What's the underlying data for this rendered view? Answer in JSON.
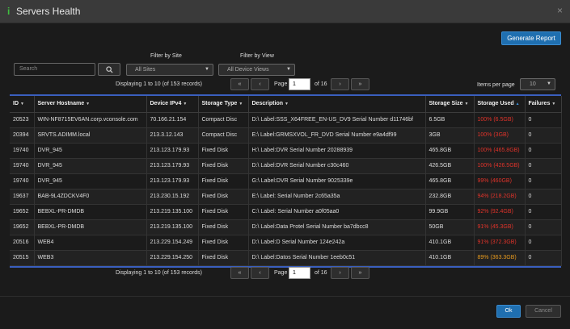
{
  "window": {
    "title": "Servers Health",
    "close_glyph": "×",
    "icon": "info-icon"
  },
  "toolbar": {
    "generate_report": "Generate Report"
  },
  "filters": {
    "search_placeholder": "Search",
    "site_label": "Filter by Site",
    "site_value": "All Sites",
    "view_label": "Filter by View",
    "view_value": "All Device Views"
  },
  "pager": {
    "top_info": "Displaying 1 to 10 (of 153 records)",
    "bottom_info": "Displaying 1 to 10 (of 153 records)",
    "first": "«",
    "prev": "‹",
    "next": "›",
    "last": "»",
    "page_label": "Page",
    "page_value": "1",
    "of_label": "of 16",
    "items_per_page_label": "Items per page",
    "items_per_page": "10"
  },
  "table": {
    "columns": [
      "ID",
      "Server Hostname",
      "Device IPv4",
      "Storage Type",
      "Description",
      "Storage Size",
      "Storage Used",
      "Failures"
    ],
    "rows": [
      [
        "20523",
        "WIN-NF8715EV6AN.corp.vconsole.com",
        "70.166.21.154",
        "Compact Disc",
        "D:\\ Label:SSS_X64FREE_EN-US_DV9 Serial Number d11746bf",
        "6.5GB",
        "100% (6.5GB)",
        "0"
      ],
      [
        "20394",
        "SRVTS.ADIMM.local",
        "213.3.12.143",
        "Compact Disc",
        "E:\\ Label:GRMSXVOL_FR_DVD Serial Number e9a4df99",
        "3GB",
        "100% (3GB)",
        "0"
      ],
      [
        "19740",
        "DVR_945",
        "213.123.179.93",
        "Fixed Disk",
        "H:\\ Label:DVR Serial Number 20288939",
        "465.8GB",
        "100% (465.8GB)",
        "0"
      ],
      [
        "19740",
        "DVR_945",
        "213.123.179.93",
        "Fixed Disk",
        "D:\\ Label:DVR Serial Number c30c460",
        "426.5GB",
        "100% (426.5GB)",
        "0"
      ],
      [
        "19740",
        "DVR_945",
        "213.123.179.93",
        "Fixed Disk",
        "G:\\ Label:DVR Serial Number 9025339e",
        "465.8GB",
        "99% (460GB)",
        "0"
      ],
      [
        "19637",
        "BAB-9L4ZDCKV4F0",
        "213.230.15.192",
        "Fixed Disk",
        "E:\\ Label: Serial Number 2c65a35a",
        "232.8GB",
        "94% (218.2GB)",
        "0"
      ],
      [
        "19652",
        "BEBXL-PR-DMDB",
        "213.219.135.100",
        "Fixed Disk",
        "C:\\ Label: Serial Number a0f05aa0",
        "99.9GB",
        "92% (92.4GB)",
        "0"
      ],
      [
        "19652",
        "BEBXL-PR-DMDB",
        "213.219.135.100",
        "Fixed Disk",
        "D:\\ Label:Data Protel Serial Number ba7dbcc8",
        "50GB",
        "91% (45.3GB)",
        "0"
      ],
      [
        "20516",
        "WEB4",
        "213.229.154.249",
        "Fixed Disk",
        "D:\\ Label:D Serial Number 124e242a",
        "410.1GB",
        "91% (372.3GB)",
        "0"
      ],
      [
        "20515",
        "WEB3",
        "213.229.154.250",
        "Fixed Disk",
        "D:\\ Label:Datos Serial Number 1eeb0c51",
        "410.1GB",
        "89% (363.3GB)",
        "0"
      ]
    ],
    "used_colors": [
      "red",
      "red",
      "red",
      "red",
      "red",
      "red",
      "red",
      "red",
      "red",
      "orange"
    ]
  },
  "colors": {
    "accent": "#1f6fb0",
    "danger": "#e0332a",
    "warning": "#e79a1e",
    "table_border": "#3a5fbf"
  },
  "footer": {
    "ok": "Ok",
    "cancel": "Cancel"
  }
}
